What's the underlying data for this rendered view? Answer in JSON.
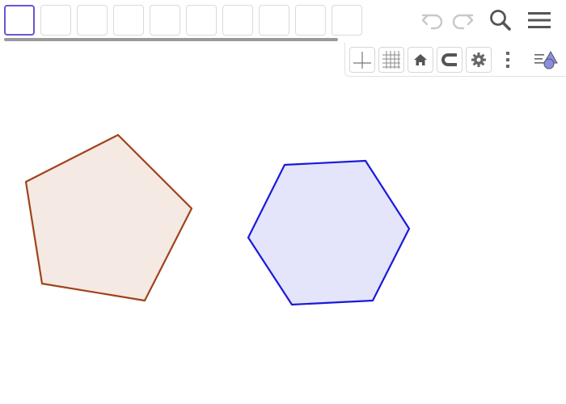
{
  "toolbar": {
    "tool_slots": [
      "",
      "",
      "",
      "",
      "",
      "",
      "",
      "",
      "",
      ""
    ],
    "selected_slot": 0,
    "icons": {
      "undo": "undo-arrow-icon",
      "redo": "redo-arrow-icon",
      "search": "search-magnifier-icon",
      "menu": "hamburger-menu-icon"
    }
  },
  "style_bar": {
    "icons": [
      "axes-icon",
      "grid-icon",
      "home-icon",
      "snap-magnet-icon",
      "settings-gear-icon",
      "more-vertical-icon",
      "algebra-view-toggle-icon"
    ]
  },
  "canvas": {
    "shapes": [
      {
        "type": "pentagon",
        "stroke": "#a0431a",
        "fill": "#f5e9e4"
      },
      {
        "type": "hexagon",
        "stroke": "#1a1ad9",
        "fill": "#e4e4fa"
      }
    ]
  },
  "colors": {
    "accent": "#6557d2",
    "icon_gray": "#666666",
    "icon_disabled": "#c8c8c8"
  }
}
